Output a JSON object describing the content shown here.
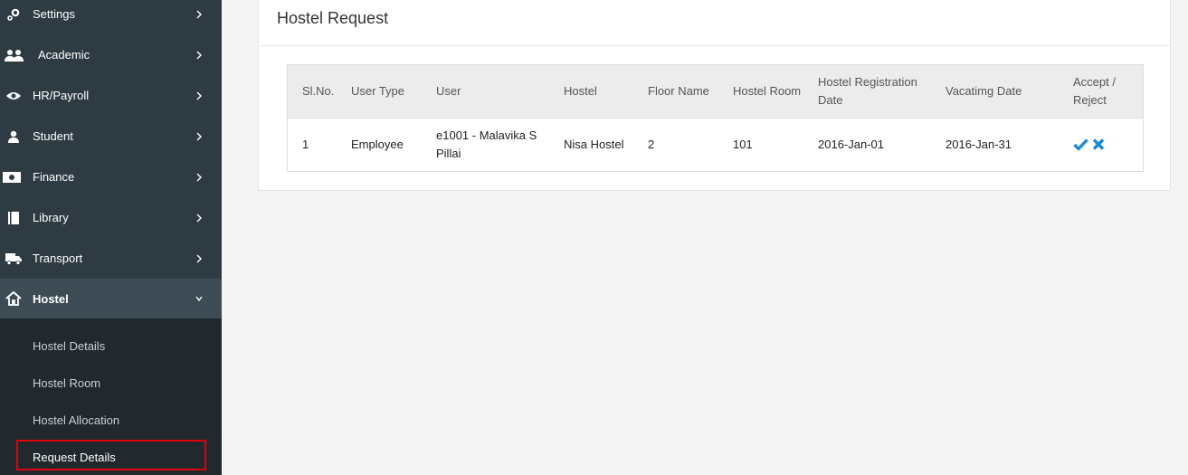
{
  "sidebar": {
    "items": [
      {
        "label": "Settings",
        "icon": "gear-icon"
      },
      {
        "label": "Academic",
        "icon": "users-icon"
      },
      {
        "label": "HR/Payroll",
        "icon": "eye-icon"
      },
      {
        "label": "Student",
        "icon": "user-icon"
      },
      {
        "label": "Finance",
        "icon": "money-icon"
      },
      {
        "label": "Library",
        "icon": "book-icon"
      },
      {
        "label": "Transport",
        "icon": "truck-icon"
      },
      {
        "label": "Hostel",
        "icon": "home-icon",
        "expanded": true
      }
    ],
    "submenu": [
      {
        "label": "Hostel Details"
      },
      {
        "label": "Hostel Room"
      },
      {
        "label": "Hostel Allocation"
      },
      {
        "label": "Request Details",
        "selected": true
      }
    ]
  },
  "panel": {
    "title": "Hostel Request",
    "table": {
      "headers": [
        "Sl.No.",
        "User Type",
        "User",
        "Hostel",
        "Floor Name",
        "Hostel Room",
        "Hostel Registration Date",
        "Vacatimg Date",
        "Accept / Reject"
      ],
      "rows": [
        {
          "sl_no": "1",
          "user_type": "Employee",
          "user": "e1001 - Malavika S Pillai",
          "hostel": "Nisa Hostel",
          "floor_name": "2",
          "hostel_room": "101",
          "registration_date": "2016-Jan-01",
          "vacating_date": "2016-Jan-31"
        }
      ]
    }
  },
  "colors": {
    "sidebar_bg": "#2e3b42",
    "sidebar_active": "#3d4c54",
    "submenu_bg": "#22292e",
    "accent_blue": "#1a8ad8",
    "highlight_red": "#e0000b"
  }
}
